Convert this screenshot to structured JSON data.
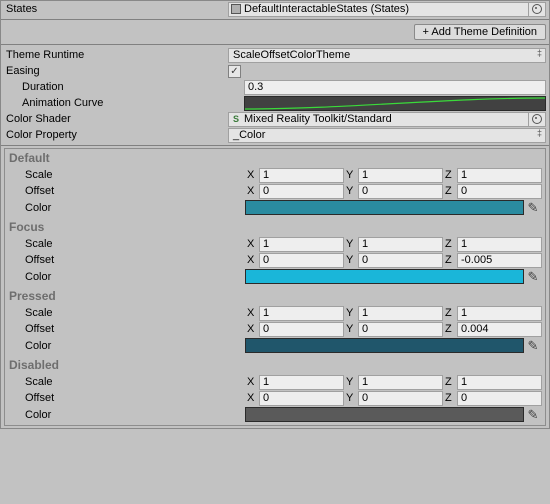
{
  "top": {
    "states_label": "States",
    "states_value": "DefaultInteractableStates (States)",
    "add_theme_btn": "+ Add Theme Definition"
  },
  "props": {
    "theme_runtime_label": "Theme Runtime",
    "theme_runtime_value": "ScaleOffsetColorTheme",
    "easing_label": "Easing",
    "easing_checked_glyph": "✓",
    "duration_label": "Duration",
    "duration_value": "0.3",
    "anim_curve_label": "Animation Curve",
    "color_shader_label": "Color Shader",
    "color_shader_value": "Mixed Reality Toolkit/Standard",
    "color_property_label": "Color Property",
    "color_property_value": "_Color"
  },
  "vec_labels": {
    "x": "X",
    "y": "Y",
    "z": "Z"
  },
  "field_labels": {
    "scale": "Scale",
    "offset": "Offset",
    "color": "Color"
  },
  "states": {
    "default": {
      "header": "Default",
      "scale": {
        "x": "1",
        "y": "1",
        "z": "1"
      },
      "offset": {
        "x": "0",
        "y": "0",
        "z": "0"
      },
      "color": "#2a8ba0"
    },
    "focus": {
      "header": "Focus",
      "scale": {
        "x": "1",
        "y": "1",
        "z": "1"
      },
      "offset": {
        "x": "0",
        "y": "0",
        "z": "-0.005"
      },
      "color": "#1ab6d9"
    },
    "pressed": {
      "header": "Pressed",
      "scale": {
        "x": "1",
        "y": "1",
        "z": "1"
      },
      "offset": {
        "x": "0",
        "y": "0",
        "z": "0.004"
      },
      "color": "#20566b"
    },
    "disabled": {
      "header": "Disabled",
      "scale": {
        "x": "1",
        "y": "1",
        "z": "1"
      },
      "offset": {
        "x": "0",
        "y": "0",
        "z": "0"
      },
      "color": "#5a5a5a"
    }
  },
  "glyphs": {
    "eyedropper": "✎",
    "picker": "⊙",
    "updown": "‡",
    "shader_s": "S"
  }
}
